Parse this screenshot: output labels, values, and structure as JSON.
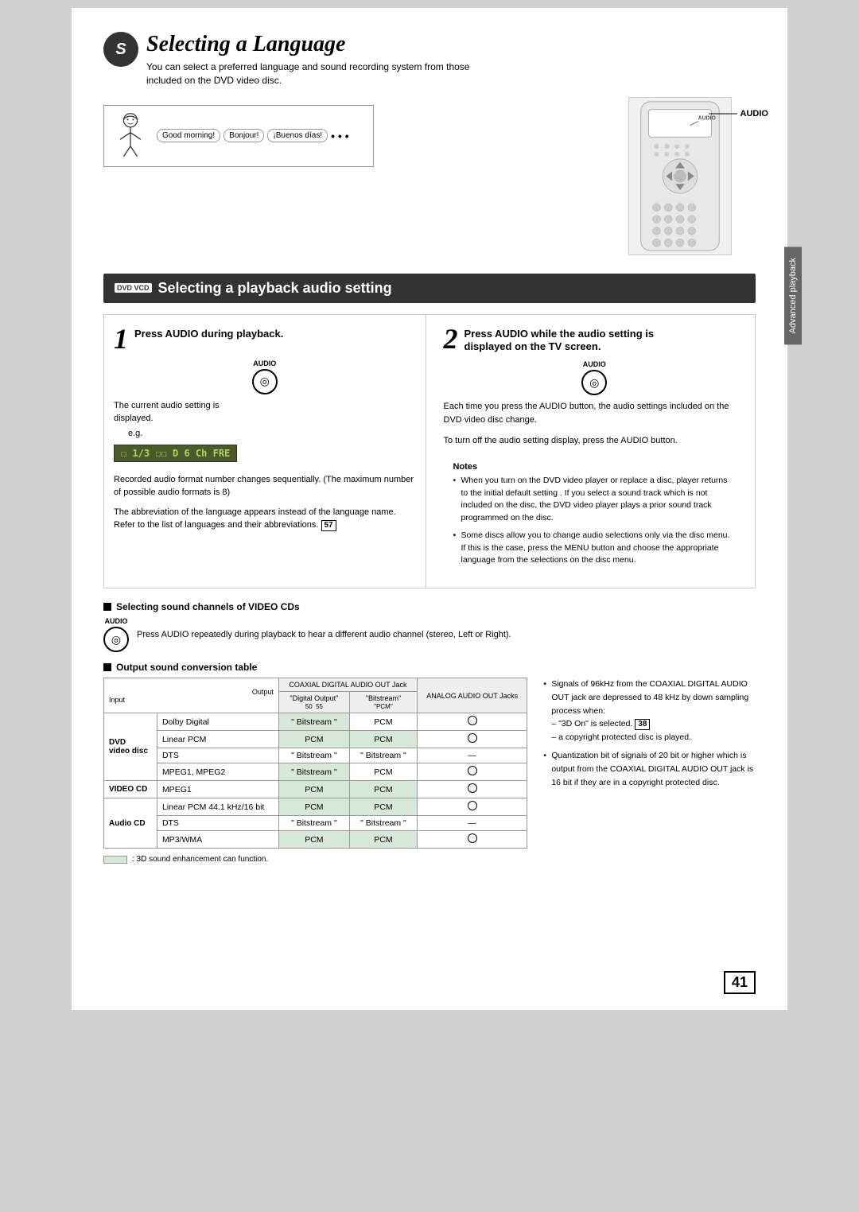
{
  "title": {
    "main": "Selecting a Language",
    "subtitle1": "You can select a preferred language and sound recording system from those",
    "subtitle2": "included on the DVD video disc."
  },
  "bubbles": {
    "good_morning": "Good morning!",
    "bonjour": "Bonjour!",
    "buenos_dias": "¡Buenos días!"
  },
  "audio_label": "AUDIO",
  "section2": {
    "icon": "DVD VCD",
    "title": "Selecting a playback audio setting"
  },
  "step1": {
    "number": "1",
    "title": "Press AUDIO during playback.",
    "audio_label": "AUDIO",
    "body1": "The current audio setting is",
    "body2": "displayed.",
    "eg": "e.g.",
    "display": "☐ 1/3 ☐☐ D 6 Ch FRE",
    "body3": "Recorded audio format number changes sequentially. (The maximum number of possible audio formats is 8)",
    "body4": "The abbreviation of the language appears instead of the language name. Refer to the list of languages and their abbreviations.",
    "page_ref": "57"
  },
  "step2": {
    "number": "2",
    "title1": "Press AUDIO while the audio setting is",
    "title2": "displayed on the TV screen.",
    "audio_label": "AUDIO",
    "body1": "Each time you press the AUDIO button, the audio settings included on the DVD video disc change.",
    "body2": "To turn off the audio setting display, press the AUDIO button.",
    "notes_title": "Notes",
    "notes": [
      "When you turn on the DVD video player or replace a disc, player returns to the initial default setting . If you select a sound track which is not included on the disc, the DVD video player plays a prior sound track programmed on the disc.",
      "Some discs allow you to change audio selections only via the disc menu. If this is the case, press the MENU button and choose the appropriate language from the selections on the disc menu."
    ]
  },
  "sound_channels": {
    "title": "Selecting sound channels of VIDEO CDs",
    "audio_label": "AUDIO",
    "body": "Press AUDIO repeatedly during playback to hear a different audio channel (stereo, Left or Right)."
  },
  "output_table": {
    "title": "Output sound conversion table",
    "col_headers": [
      "Output",
      "",
      "COAXIAL DIGITAL AUDIO OUT Jack",
      "",
      "ANALOG AUDIO OUT Jacks"
    ],
    "col_subheaders": [
      "",
      "",
      "\"Digital Output\"",
      "50  55",
      ""
    ],
    "col_sub2": [
      "",
      "",
      "\" Bitstream\"",
      "\"PCM\"",
      ""
    ],
    "input_label": "Input",
    "rows": [
      {
        "group": "DVD video disc",
        "entries": [
          {
            "input": "Dolby Digital",
            "bitstream": "\" Bitstream \"",
            "pcm": "PCM",
            "analog": "○",
            "shaded": true
          },
          {
            "input": "Linear PCM",
            "bitstream": "PCM",
            "pcm": "PCM",
            "analog": "○",
            "shaded": true
          },
          {
            "input": "DTS",
            "bitstream": "\" Bitstream \"",
            "pcm": "\" Bitstream \"",
            "analog": "—",
            "shaded": false
          },
          {
            "input": "MPEG1, MPEG2",
            "bitstream": "\" Bitstream \"",
            "pcm": "PCM",
            "analog": "○",
            "shaded": true
          }
        ]
      },
      {
        "group": "VIDEO CD",
        "entries": [
          {
            "input": "MPEG1",
            "bitstream": "PCM",
            "pcm": "PCM",
            "analog": "○",
            "shaded": true
          }
        ]
      },
      {
        "group": "Audio CD",
        "entries": [
          {
            "input": "Linear PCM 44.1 kHz/16 bit",
            "bitstream": "PCM",
            "pcm": "PCM",
            "analog": "○",
            "shaded": true
          },
          {
            "input": "DTS",
            "bitstream": "\" Bitstream \"",
            "pcm": "\" Bitstream \"",
            "analog": "—",
            "shaded": false
          },
          {
            "input": "MP3/WMA",
            "bitstream": "PCM",
            "pcm": "PCM",
            "analog": "○",
            "shaded": true
          }
        ]
      }
    ],
    "legend": ": 3D sound enhancement can function."
  },
  "bottom_notes": [
    "Signals of 96kHz from the COAXIAL DIGITAL AUDIO OUT jack are depressed to 48 kHz by down sampling process when:",
    "– \"3D On\" is selected.",
    "– a copyright protected disc is played.",
    "Quantization bit of signals of 20 bit or higher which is output from the COAXIAL DIGITAL AUDIO OUT jack is 16 bit if they are in a copyright protected disc."
  ],
  "page_number": "41",
  "right_tab": "Advanced playback"
}
